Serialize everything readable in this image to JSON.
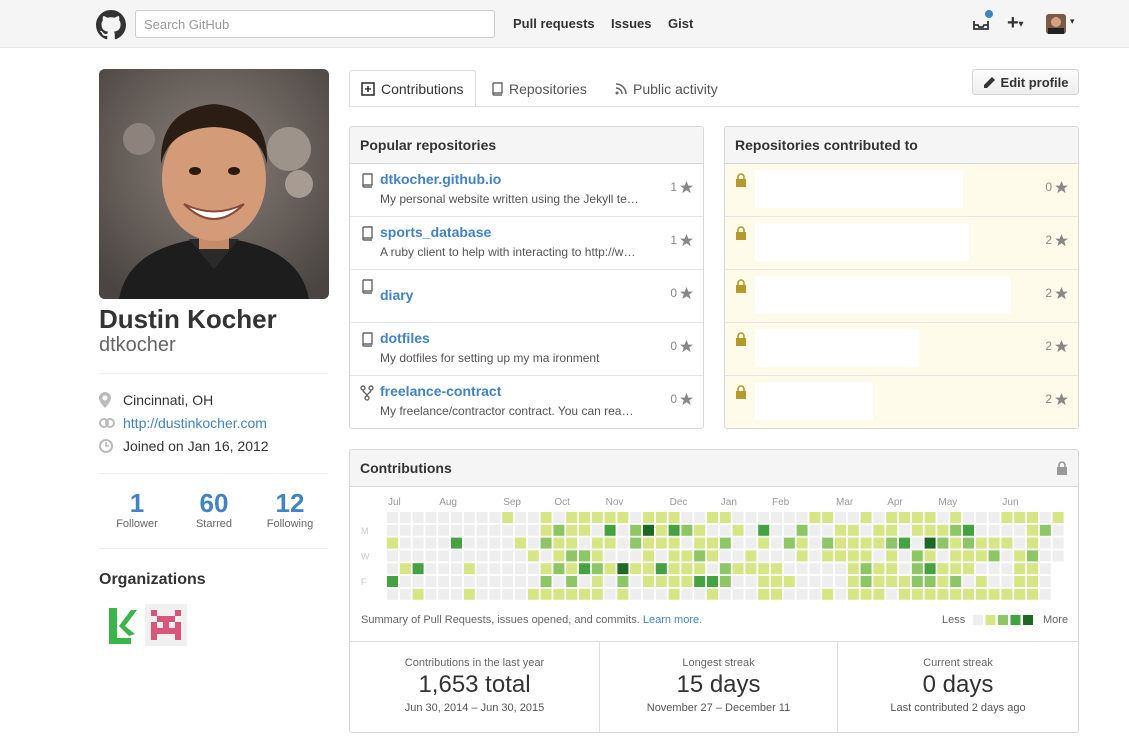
{
  "header": {
    "search_placeholder": "Search GitHub",
    "nav": [
      "Pull requests",
      "Issues",
      "Gist"
    ],
    "plus": "+"
  },
  "profile": {
    "fullname": "Dustin Kocher",
    "username": "dtkocher",
    "location": "Cincinnati, OH",
    "website": "http://dustinkocher.com",
    "joined": "Joined on Jan 16, 2012",
    "stats": [
      {
        "num": "1",
        "label": "Follower"
      },
      {
        "num": "60",
        "label": "Starred"
      },
      {
        "num": "12",
        "label": "Following"
      }
    ],
    "organizations_title": "Organizations"
  },
  "tabs": [
    "Contributions",
    "Repositories",
    "Public activity"
  ],
  "edit_profile": "Edit profile",
  "popular": {
    "title": "Popular repositories",
    "repos": [
      {
        "name": "dtkocher.github.io",
        "desc": "My personal website written using the Jekyll te…",
        "stars": "1",
        "icon": "repo-icon"
      },
      {
        "name": "sports_database",
        "desc": "A ruby client to help with interacting to http://w…",
        "stars": "1",
        "icon": "repo-icon"
      },
      {
        "name": "diary",
        "desc": "",
        "stars": "0",
        "icon": "repo-icon"
      },
      {
        "name": "dotfiles",
        "desc": "My dotfiles for setting up my ma        ironment",
        "stars": "0",
        "icon": "repo-icon"
      },
      {
        "name": "freelance-contract",
        "desc": "My freelance/contractor contract. You can rea…",
        "stars": "0",
        "icon": "fork-icon"
      }
    ]
  },
  "contributed": {
    "title": "Repositories contributed to",
    "repos": [
      {
        "stars": "0"
      },
      {
        "stars": "2"
      },
      {
        "stars": "2"
      },
      {
        "stars": "2"
      },
      {
        "stars": "2"
      }
    ]
  },
  "contributions": {
    "title": "Contributions",
    "months": [
      "Jul",
      "Aug",
      "Sep",
      "Oct",
      "Nov",
      "Dec",
      "Jan",
      "Feb",
      "Mar",
      "Apr",
      "May",
      "Jun"
    ],
    "days": [
      "M",
      "W",
      "F"
    ],
    "summary": "Summary of Pull Requests, issues opened, and commits.",
    "learn_more": "Learn more.",
    "less": "Less",
    "more": "More",
    "colors": [
      "#eeeeee",
      "#d6e685",
      "#8cc665",
      "#44a340",
      "#1e6823"
    ],
    "stats": [
      {
        "title": "Contributions in the last year",
        "value": "1,653 total",
        "dates": "Jun 30, 2014 – Jun 30, 2015"
      },
      {
        "title": "Longest streak",
        "value": "15 days",
        "dates": "November 27 – December 11"
      },
      {
        "title": "Current streak",
        "value": "0 days",
        "dates": "Last contributed 2 days ago"
      }
    ]
  }
}
